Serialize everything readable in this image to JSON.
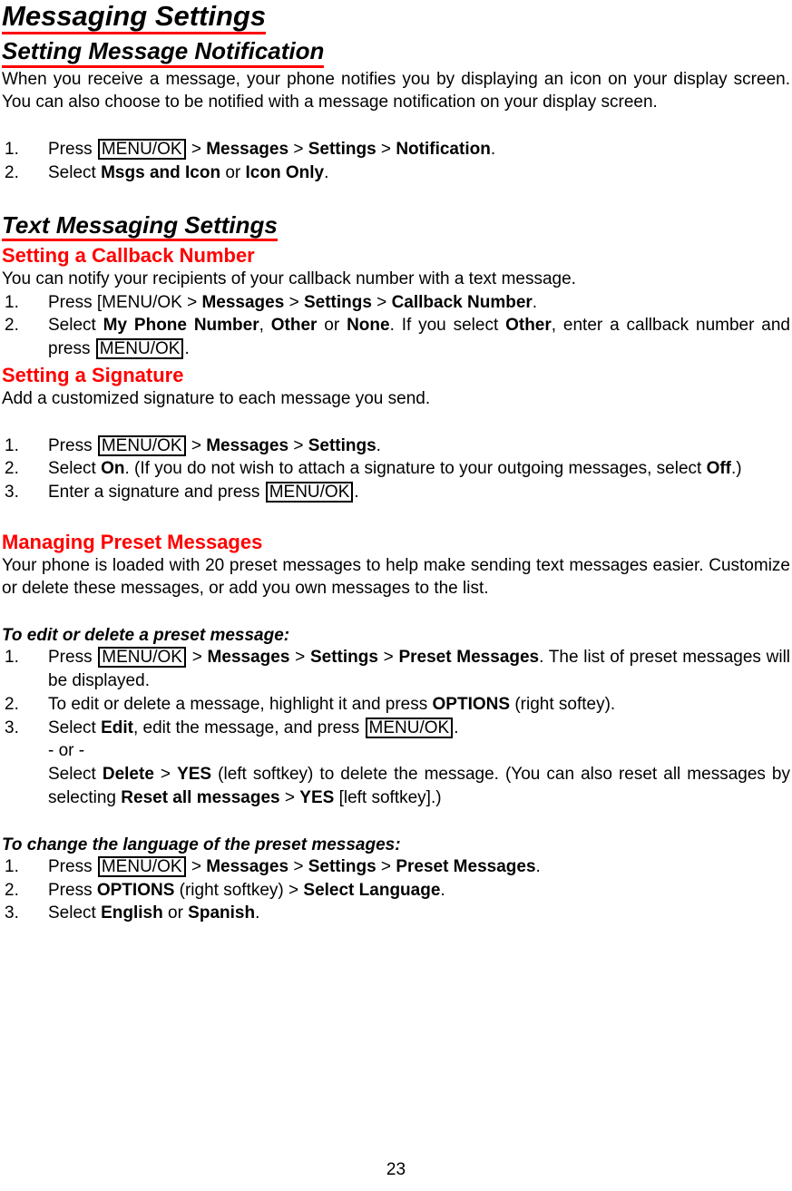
{
  "document": {
    "title": "Messaging Settings",
    "page_number": "23",
    "accent_color": "#FF0000",
    "text_color": "#000000",
    "background_color": "#FFFFFF"
  },
  "section_notification": {
    "heading": "Setting Message Notification",
    "paragraph": "When you receive a message, your phone notifies you by displaying an icon on your display screen. You can also choose to be notified with a message notification on your display screen.",
    "steps": [
      {
        "number": "1.",
        "pre": "Press ",
        "key": "MENU/OK",
        "post_bold_chain": " > Messages > Settings > Notification",
        "parts": [
          {
            "t": "Press ",
            "style": "normal"
          },
          {
            "t": "MENU/OK",
            "style": "key"
          },
          {
            "t": " > ",
            "style": "normal"
          },
          {
            "t": "Messages",
            "style": "bold"
          },
          {
            "t": " > ",
            "style": "normal"
          },
          {
            "t": "Settings",
            "style": "bold"
          },
          {
            "t": " > ",
            "style": "normal"
          },
          {
            "t": "Notification",
            "style": "bold"
          },
          {
            "t": ".",
            "style": "normal"
          }
        ]
      },
      {
        "number": "2.",
        "parts": [
          {
            "t": "Select ",
            "style": "normal"
          },
          {
            "t": "Msgs and Icon",
            "style": "bold"
          },
          {
            "t": " or ",
            "style": "normal"
          },
          {
            "t": "Icon Only",
            "style": "bold"
          },
          {
            "t": ".",
            "style": "normal"
          }
        ]
      }
    ]
  },
  "section_text_messaging": {
    "heading": "Text Messaging Settings"
  },
  "section_callback": {
    "heading": "Setting a Callback Number",
    "paragraph": "You can notify your recipients of your callback number with a text message.",
    "steps": [
      {
        "number": "1.",
        "parts": [
          {
            "t": "Press [MENU/OK > ",
            "style": "normal"
          },
          {
            "t": "Messages",
            "style": "bold"
          },
          {
            "t": " > ",
            "style": "normal"
          },
          {
            "t": "Settings",
            "style": "bold"
          },
          {
            "t": " > ",
            "style": "normal"
          },
          {
            "t": "Callback Number",
            "style": "bold"
          },
          {
            "t": ".",
            "style": "normal"
          }
        ]
      },
      {
        "number": "2.",
        "parts": [
          {
            "t": "Select ",
            "style": "normal"
          },
          {
            "t": "My Phone Number",
            "style": "bold"
          },
          {
            "t": ", ",
            "style": "normal"
          },
          {
            "t": "Other",
            "style": "bold"
          },
          {
            "t": " or ",
            "style": "normal"
          },
          {
            "t": "None",
            "style": "bold"
          },
          {
            "t": ". If you select ",
            "style": "normal"
          },
          {
            "t": "Other",
            "style": "bold"
          },
          {
            "t": ", enter a callback number and press ",
            "style": "normal"
          },
          {
            "t": "MENU/OK",
            "style": "key"
          },
          {
            "t": ".",
            "style": "normal"
          }
        ]
      }
    ]
  },
  "section_signature": {
    "heading": "Setting a Signature",
    "paragraph": "Add a customized signature to each message you send.",
    "steps": [
      {
        "number": "1.",
        "parts": [
          {
            "t": "Press ",
            "style": "normal"
          },
          {
            "t": "MENU/OK",
            "style": "key"
          },
          {
            "t": " > ",
            "style": "normal"
          },
          {
            "t": "Messages",
            "style": "bold"
          },
          {
            "t": " > ",
            "style": "normal"
          },
          {
            "t": "Settings",
            "style": "bold"
          },
          {
            "t": ".",
            "style": "normal"
          }
        ]
      },
      {
        "number": "2.",
        "parts": [
          {
            "t": "Select ",
            "style": "normal"
          },
          {
            "t": "On",
            "style": "bold"
          },
          {
            "t": ". (If you do not wish to attach a signature to your outgoing messages, select ",
            "style": "normal"
          },
          {
            "t": "Off",
            "style": "bold"
          },
          {
            "t": ".)",
            "style": "normal"
          }
        ]
      },
      {
        "number": "3.",
        "parts": [
          {
            "t": "Enter a signature and press ",
            "style": "normal"
          },
          {
            "t": "MENU/OK",
            "style": "key"
          },
          {
            "t": ".",
            "style": "normal"
          }
        ]
      }
    ]
  },
  "section_preset": {
    "heading": "Managing Preset Messages",
    "paragraph": "Your phone is loaded with 20 preset messages to help make sending text messages easier. Customize or delete these messages, or add you own messages to the list.",
    "subhead_edit": "To edit or delete a preset message:",
    "steps_edit": [
      {
        "number": "1.",
        "parts": [
          {
            "t": "Press ",
            "style": "normal"
          },
          {
            "t": "MENU/OK",
            "style": "key"
          },
          {
            "t": " > ",
            "style": "normal"
          },
          {
            "t": "Messages",
            "style": "bold"
          },
          {
            "t": " > ",
            "style": "normal"
          },
          {
            "t": "Settings",
            "style": "bold"
          },
          {
            "t": " > ",
            "style": "normal"
          },
          {
            "t": "Preset Messages",
            "style": "bold"
          },
          {
            "t": ". The list of preset messages will be displayed.",
            "style": "normal"
          }
        ]
      },
      {
        "number": "2.",
        "parts": [
          {
            "t": "To edit or delete a message, highlight it and press ",
            "style": "normal"
          },
          {
            "t": "OPTIONS",
            "style": "bold"
          },
          {
            "t": " (right softey).",
            "style": "normal"
          }
        ]
      },
      {
        "number": "3.",
        "parts": [
          {
            "t": "Select ",
            "style": "normal"
          },
          {
            "t": "Edit",
            "style": "bold"
          },
          {
            "t": ", edit the message, and press ",
            "style": "normal"
          },
          {
            "t": "MENU/OK",
            "style": "key"
          },
          {
            "t": ".",
            "style": "normal"
          }
        ],
        "continuation_or": "- or -",
        "continuation_parts": [
          {
            "t": "Select ",
            "style": "normal"
          },
          {
            "t": "Delete",
            "style": "bold"
          },
          {
            "t": " > ",
            "style": "normal"
          },
          {
            "t": "YES",
            "style": "bold"
          },
          {
            "t": " (left softkey) to delete the message. (You can also reset all messages by selecting ",
            "style": "normal"
          },
          {
            "t": "Reset all messages",
            "style": "bold"
          },
          {
            "t": " > ",
            "style": "normal"
          },
          {
            "t": "YES",
            "style": "bold"
          },
          {
            "t": " [left softkey].)",
            "style": "normal"
          }
        ]
      }
    ],
    "subhead_language": "To change the language of the preset messages:",
    "steps_language": [
      {
        "number": "1.",
        "parts": [
          {
            "t": "Press ",
            "style": "normal"
          },
          {
            "t": "MENU/OK",
            "style": "key"
          },
          {
            "t": " > ",
            "style": "normal"
          },
          {
            "t": "Messages",
            "style": "bold"
          },
          {
            "t": " > ",
            "style": "normal"
          },
          {
            "t": "Settings",
            "style": "bold"
          },
          {
            "t": " > ",
            "style": "normal"
          },
          {
            "t": "Preset Messages",
            "style": "bold"
          },
          {
            "t": ".",
            "style": "normal"
          }
        ]
      },
      {
        "number": "2.",
        "parts": [
          {
            "t": "Press ",
            "style": "normal"
          },
          {
            "t": "OPTIONS",
            "style": "bold"
          },
          {
            "t": " (right softkey) > ",
            "style": "normal"
          },
          {
            "t": "Select Language",
            "style": "bold"
          },
          {
            "t": ".",
            "style": "normal"
          }
        ]
      },
      {
        "number": "3.",
        "parts": [
          {
            "t": "Select ",
            "style": "normal"
          },
          {
            "t": "English",
            "style": "bold"
          },
          {
            "t": " or ",
            "style": "normal"
          },
          {
            "t": "Spanish",
            "style": "bold"
          },
          {
            "t": ".",
            "style": "normal"
          }
        ]
      }
    ]
  }
}
